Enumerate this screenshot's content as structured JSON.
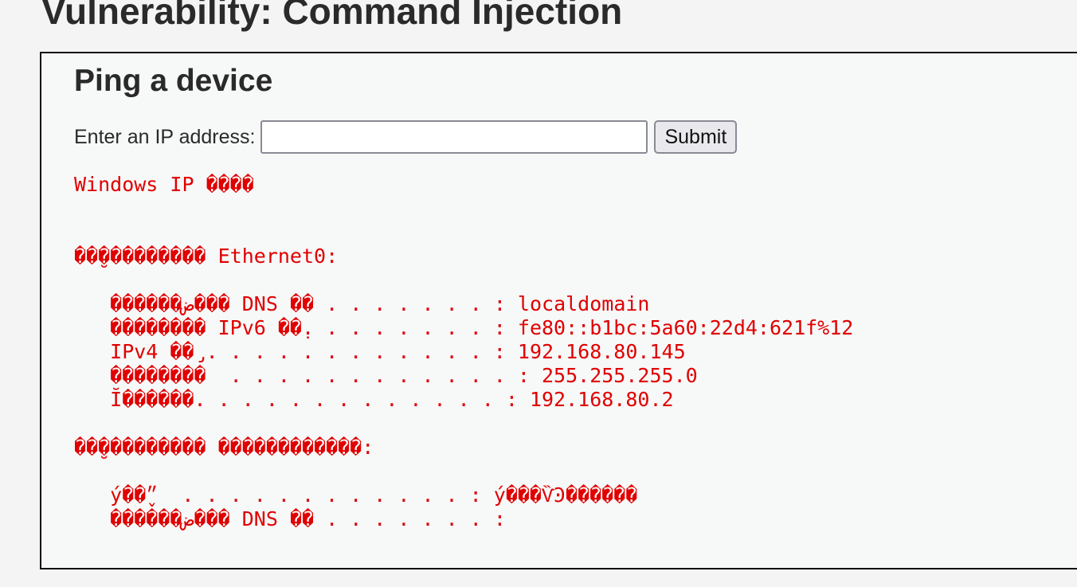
{
  "page": {
    "title": "Vulnerability: Command Injection"
  },
  "form": {
    "heading": "Ping a device",
    "ip_label": "Enter an IP address:",
    "ip_value": "",
    "ip_placeholder": "",
    "submit_label": "Submit"
  },
  "output": {
    "text": "Windows IP ����\n\n\n��̮��������� Ethernet0:\n\n   ������ض��� DNS ��׺ . . . . . . . : localdomain\n   �������� IPv6 ��̣. . . . . . . . : fe80::b1bc:5a60:22d4:621f%12\n   IPv4 ��̡. . . . . . . . . . . . : 192.168.80.145\n   ��������  . . . . . . . . . . . . : 255.255.255.0\n   Ĭ������. . . . . . . . . . . . . : 192.168.80.2\n\n��̮��������� ������������:\n\n   ý��̬״  . . . . . . . . . . . . : ý���ѶϿ������\n   ������ض��� DNS ��׺ . . . . . . . :"
  },
  "colors": {
    "output_text": "#e00000",
    "page_background": "#f4f4f4",
    "box_border": "#111111"
  }
}
